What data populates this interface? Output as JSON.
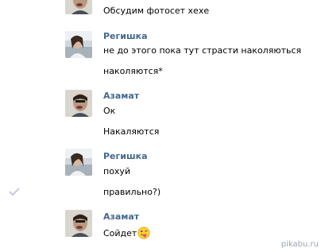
{
  "messages": [
    {
      "author": "",
      "lines": [
        "Обсудим фотосет хехе"
      ]
    },
    {
      "author": "Регишка",
      "lines": [
        "не до этого пока тут страсти наколяються",
        "наколяются*"
      ]
    },
    {
      "author": "Азамат",
      "lines": [
        "Ок",
        "Накаляются"
      ]
    },
    {
      "author": "Регишка",
      "lines": [
        "похуй",
        "правильно?)"
      ]
    },
    {
      "author": "Азамат",
      "lines": [
        "Сойдет"
      ]
    }
  ],
  "icons": {
    "read_status": "checkmark-icon",
    "emoji": "tongue-wink-emoji-icon"
  },
  "colors": {
    "author_name": "#45688e",
    "checkmark": "#c3cdd7"
  },
  "watermark": "pikabu.ru"
}
